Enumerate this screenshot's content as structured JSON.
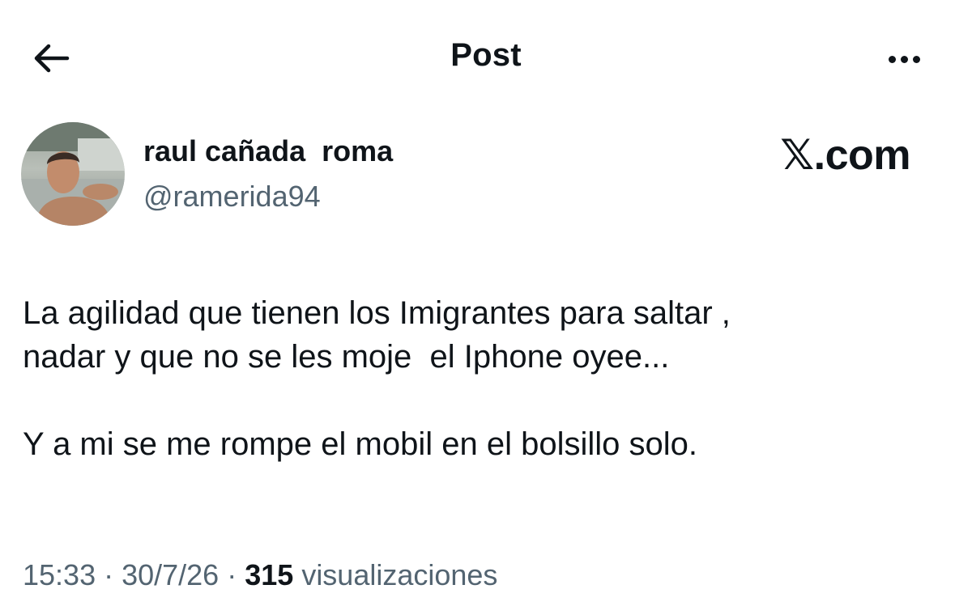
{
  "header": {
    "title": "Post",
    "back_icon": "arrow-left-icon",
    "more_icon": "more-horizontal-icon"
  },
  "author": {
    "display_name": "raul cañada  roma",
    "handle": "@ramerida94"
  },
  "watermark": "𝕏.com",
  "post": {
    "lines": [
      "La agilidad que tienen los Imigrantes para saltar ,",
      "nadar y que no se les moje  el Iphone oyee...",
      "Y a mi se me rompe el mobil en el bolsillo solo."
    ]
  },
  "meta": {
    "time": "15:33",
    "separator": " · ",
    "date": "30/7/26",
    "views_count": "315",
    "views_label": "visualizaciones"
  },
  "colors": {
    "text": "#0f1419",
    "secondary": "#536471",
    "background": "#ffffff"
  }
}
